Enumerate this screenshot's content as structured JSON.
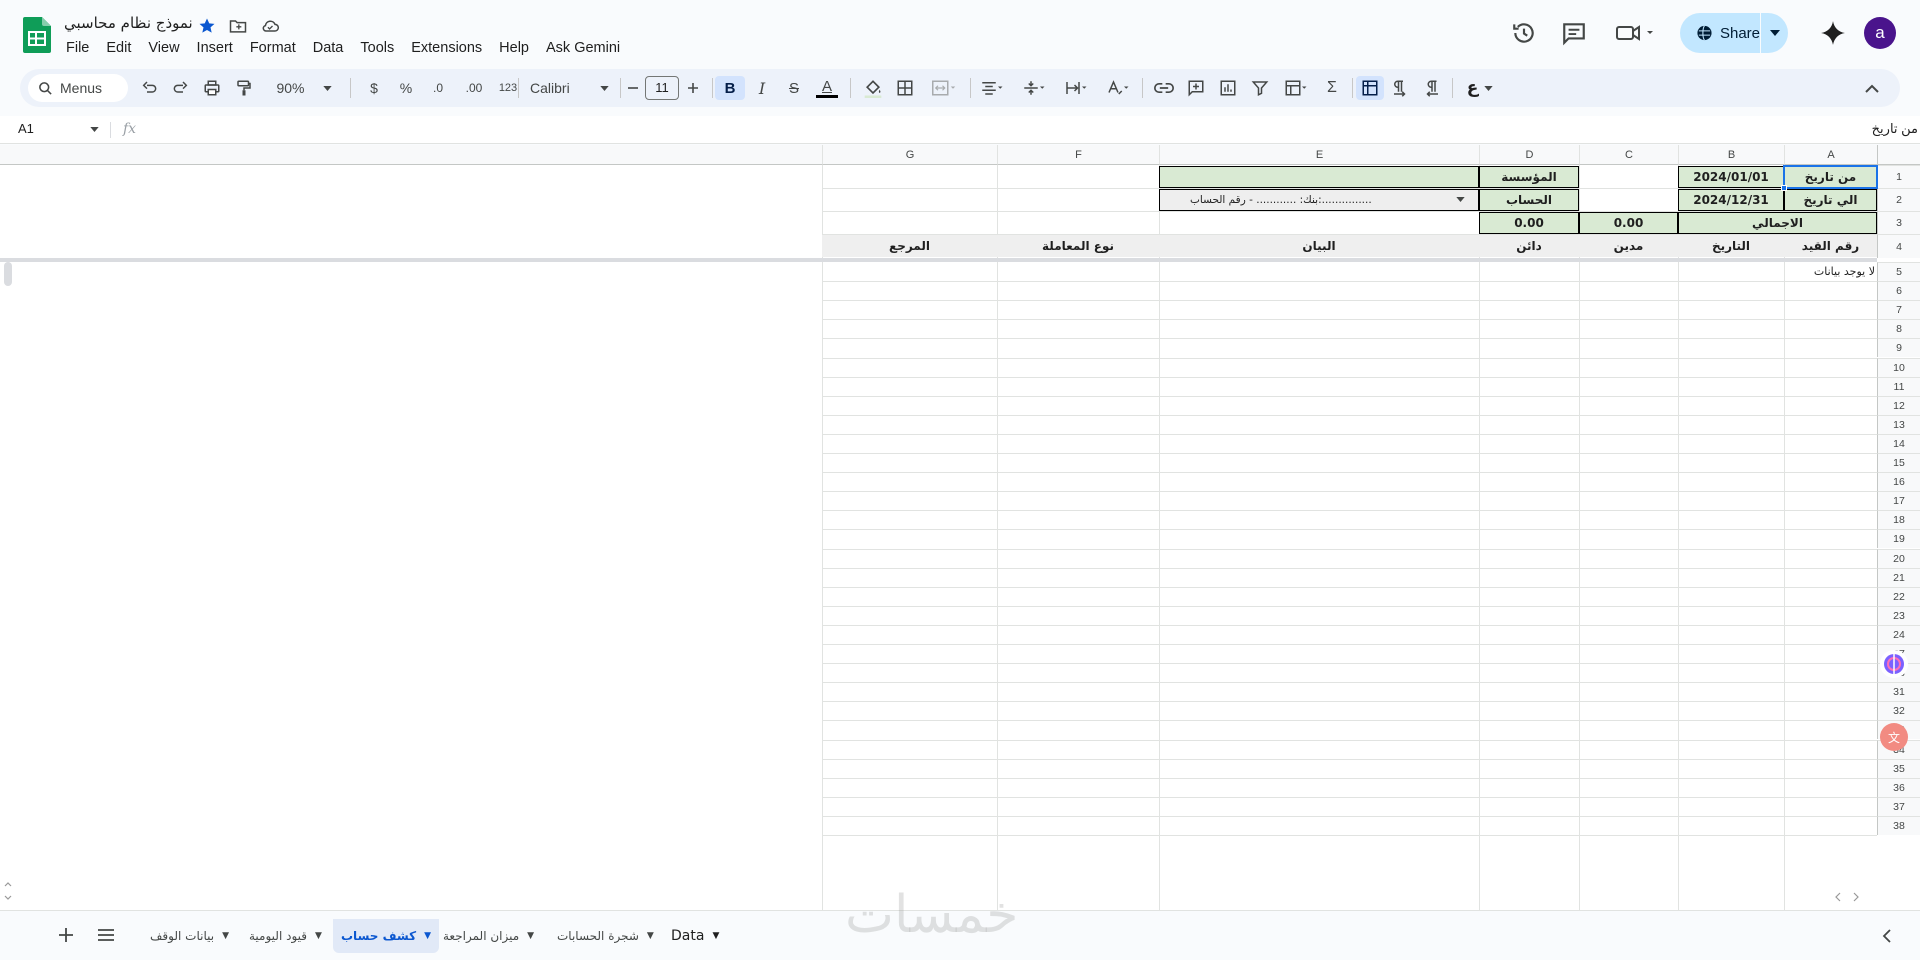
{
  "app": {
    "doc_title": "نموذج نظام محاسبي",
    "menu": [
      "File",
      "Edit",
      "View",
      "Insert",
      "Format",
      "Data",
      "Tools",
      "Extensions",
      "Help",
      "Ask Gemini"
    ],
    "share_label": "Share",
    "avatar_letter": "a",
    "accent": "#c2e7ff"
  },
  "toolbar": {
    "menus_label": "Menus",
    "zoom": "90%",
    "currency": "$",
    "percent": "%",
    "decrease_decimal": ".0",
    "increase_decimal": ".00",
    "number_format": "123",
    "font": "Calibri",
    "font_size": "11",
    "bold": "B",
    "italic": "I",
    "strike": "S",
    "text_color": "A",
    "sigma": "Σ"
  },
  "formula_bar": {
    "name_box": "A1",
    "fx": "fx",
    "content": "من تاريخ"
  },
  "grid": {
    "columns": [
      "A",
      "B",
      "C",
      "D",
      "E",
      "F",
      "G"
    ],
    "rows": [
      "1",
      "2",
      "3",
      "4",
      "5",
      "6",
      "7",
      "8",
      "9",
      "10",
      "11",
      "12",
      "13",
      "14",
      "15",
      "16",
      "17",
      "18",
      "19",
      "20",
      "21",
      "22",
      "23",
      "24",
      "27",
      "28",
      "31",
      "32",
      "33",
      "34",
      "35",
      "36",
      "37",
      "38"
    ],
    "cells": {
      "a1": "من تاريخ",
      "b1": "2024/01/01",
      "d1": "المؤسسة",
      "a2": "الي تاريخ",
      "b2": "2024/12/31",
      "d2": "الحساب",
      "e2": "بنك: ............ - رقم الحساب:...............",
      "ab3": "الاجمالي",
      "c3": "0.00",
      "d3": "0.00",
      "a4": "رقم القيد",
      "b4": "التاريخ",
      "c4": "مدين",
      "d4": "دائن",
      "e4": "البيان",
      "f4": "نوع المعاملة",
      "g4": "المرجع",
      "a5": "لا يوجد بيانات"
    },
    "highlight_color": "#d9ead3"
  },
  "sheets": {
    "tabs": [
      "بيانات الوقف",
      "قيود اليومية",
      "كشف حساب",
      "ميزان المراجعة",
      "شجرة الحسابات",
      "Data"
    ],
    "active": "كشف حساب"
  },
  "watermark": "خمسات"
}
